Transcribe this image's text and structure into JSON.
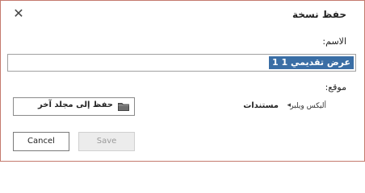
{
  "dialog": {
    "title": "حفظ نسخة",
    "name_label": "الاسم:",
    "name_value": "عرض تقديمي 1 1",
    "location_label": "موقع:",
    "folder_button_label": "حفظ إلى مجلد آخر",
    "breadcrumb": {
      "user": "أليكس ويلبر",
      "separator": "◂",
      "current": "مستندات"
    },
    "buttons": {
      "save": "Save",
      "cancel": "Cancel"
    }
  },
  "colors": {
    "dialog_border": "#c47a6e",
    "selection": "#3a6ea5",
    "disabled_bg": "#ececec"
  },
  "icons": {
    "close": "close-icon",
    "folder": "folder-icon"
  }
}
